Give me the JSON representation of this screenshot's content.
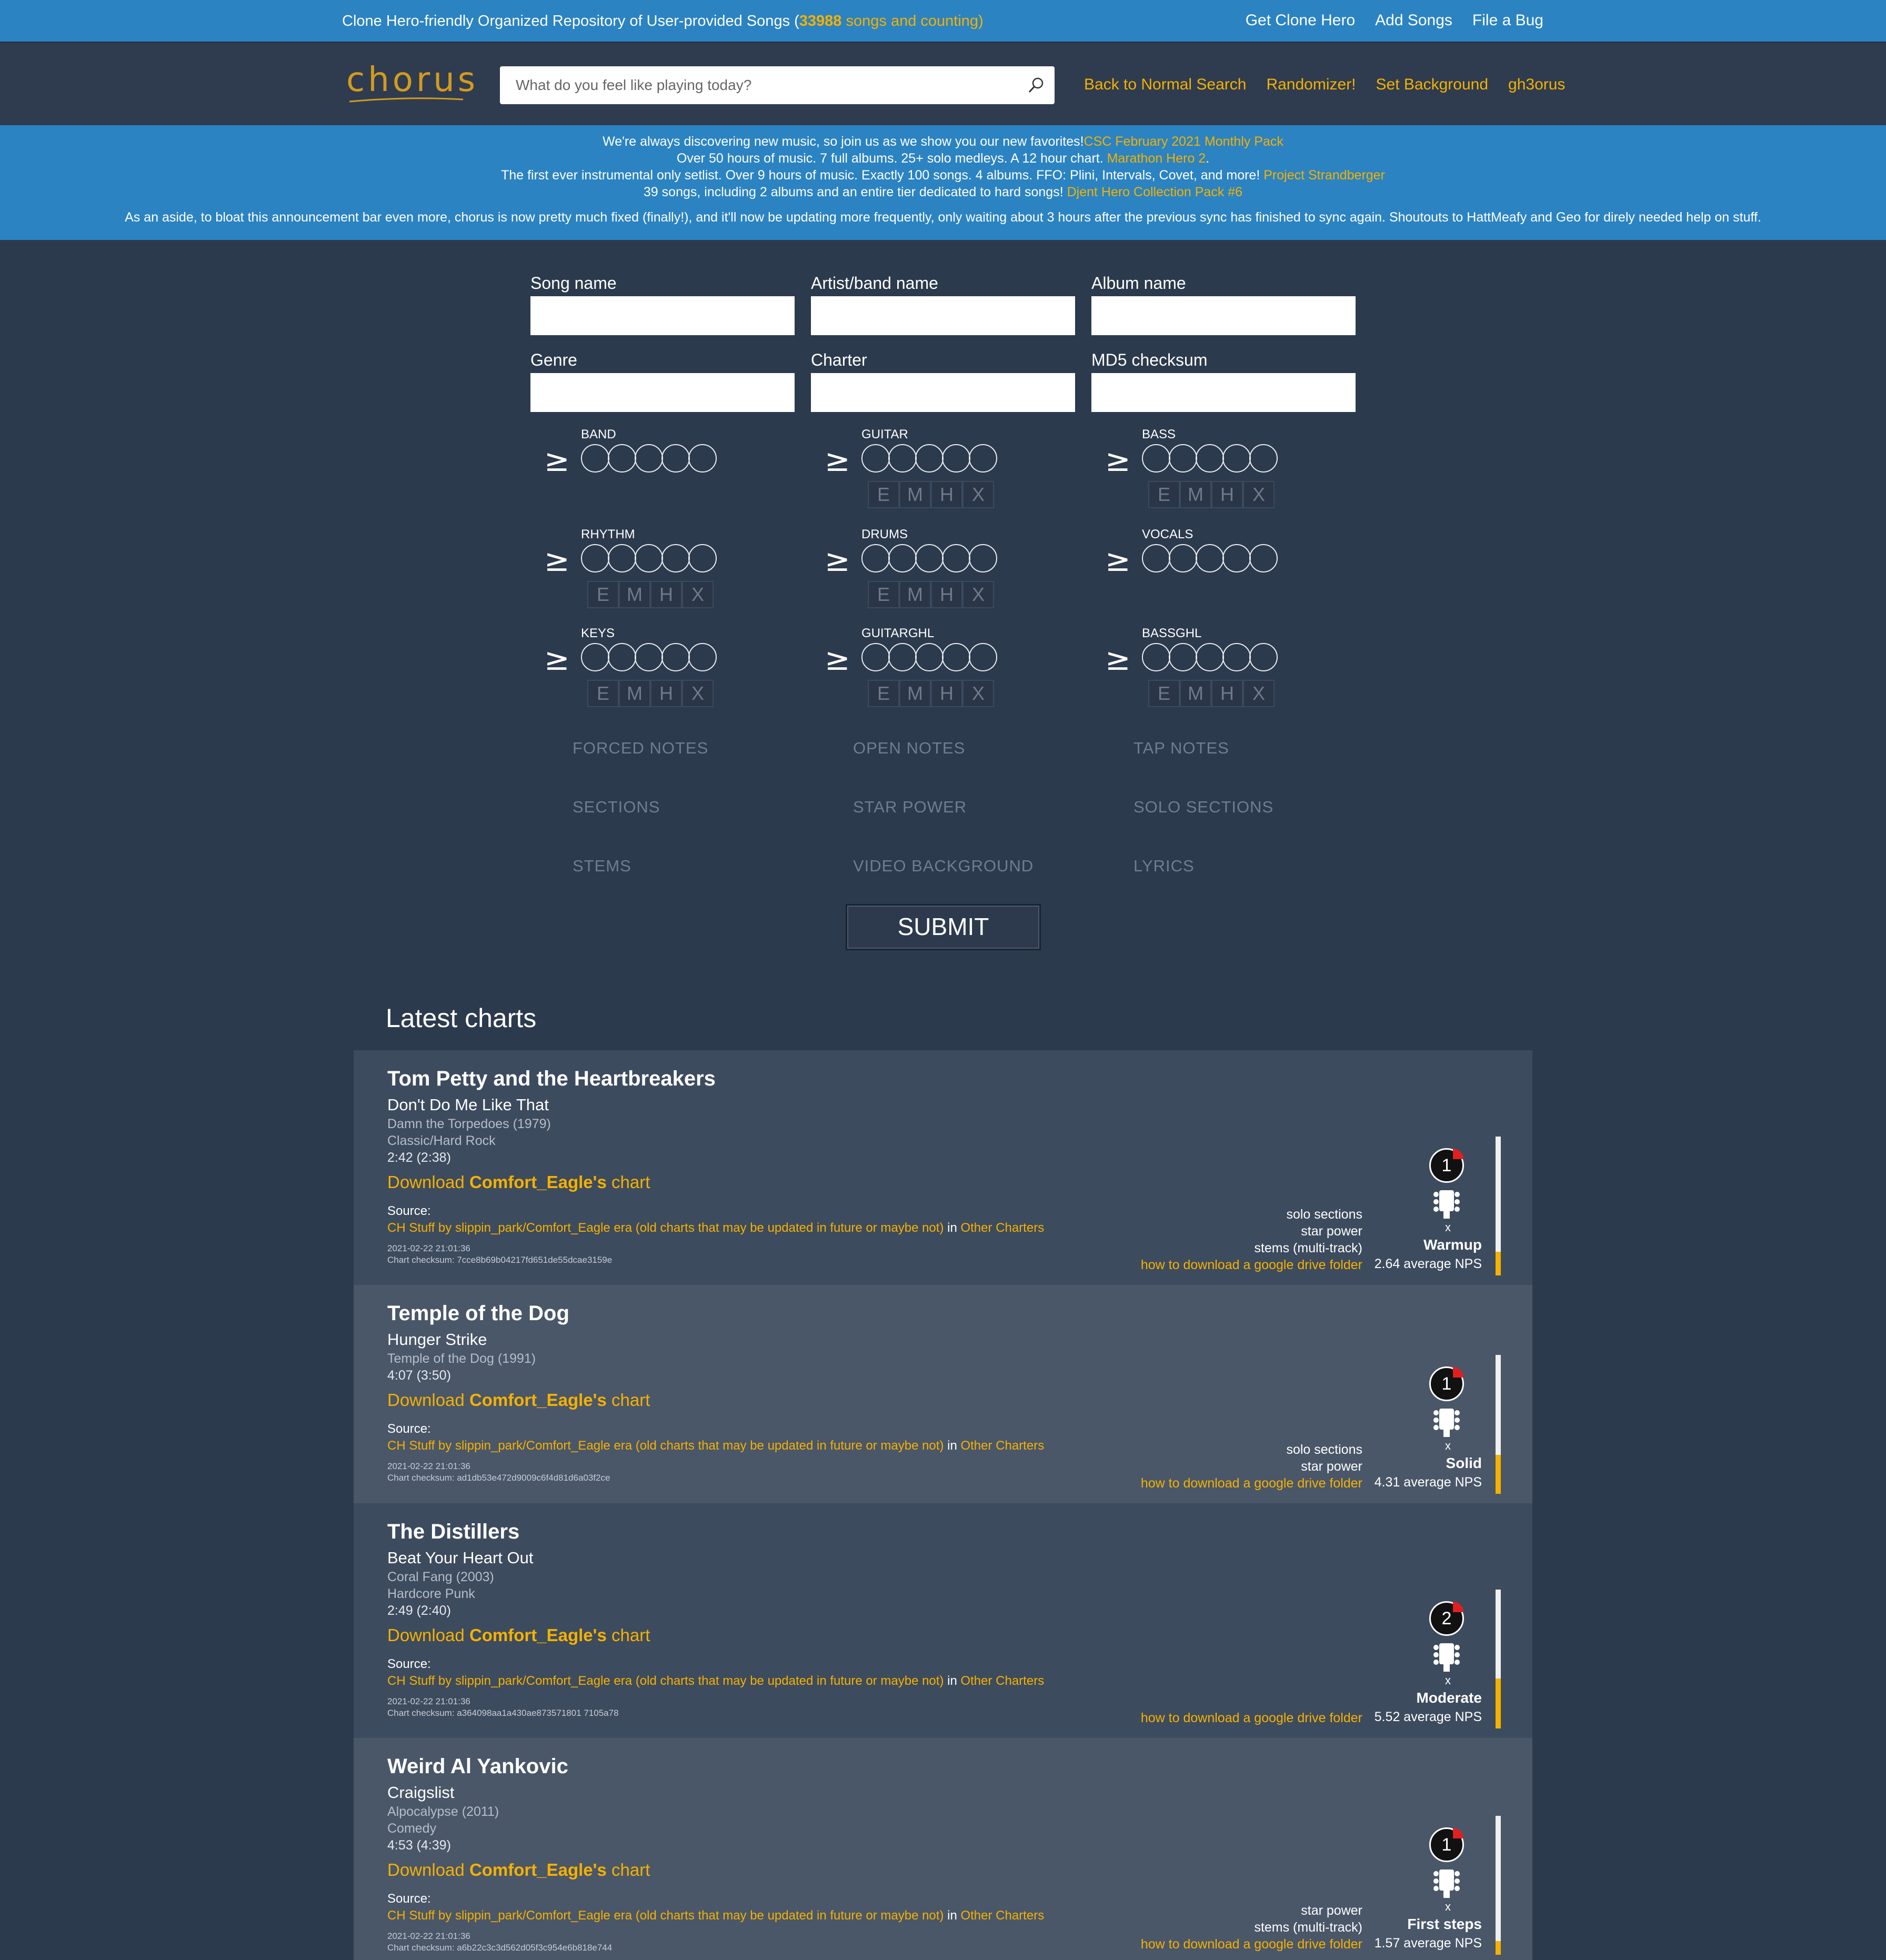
{
  "topbar": {
    "tagline_prefix": "Clone Hero-friendly Organized Repository of User-provided Songs (",
    "song_count": "33988",
    "tagline_suffix": " songs and counting)",
    "links": [
      "Get Clone Hero",
      "Add Songs",
      "File a Bug"
    ]
  },
  "header": {
    "logo": "chorus",
    "search_placeholder": "What do you feel like playing today?",
    "nav": [
      "Back to Normal Search",
      "Randomizer!",
      "Set Background",
      "gh3orus"
    ]
  },
  "announcement": {
    "lines": [
      {
        "text": "We're always discovering new music, so join us as we show you our new favorites!",
        "link": "CSC February 2021 Monthly Pack",
        "after": ""
      },
      {
        "text": "Over 50 hours of music. 7 full albums. 25+ solo medleys. A 12 hour chart. ",
        "link": "Marathon Hero 2",
        "after": "."
      },
      {
        "text": "The first ever instrumental only setlist. Over 9 hours of music. Exactly 100 songs. 4 albums. FFO: Plini, Intervals, Covet, and more! ",
        "link": "Project Strandberger",
        "after": ""
      },
      {
        "text": "39 songs, including 2 albums and an entire tier dedicated to hard songs! ",
        "link": "Djent Hero Collection Pack #6",
        "after": ""
      }
    ],
    "aside": "As an aside, to bloat this announcement bar even more, chorus is now pretty much fixed (finally!), and it'll now be updating more frequently, only waiting about 3 hours after the previous sync has finished to sync again. Shoutouts to HattMeafy and Geo for direly needed help on stuff."
  },
  "form": {
    "fields": [
      "Song name",
      "Artist/band name",
      "Album name",
      "Genre",
      "Charter",
      "MD5 checksum"
    ],
    "ge_symbol": "≥",
    "instruments": [
      {
        "name": "BAND",
        "diffs": []
      },
      {
        "name": "GUITAR",
        "diffs": [
          "E",
          "M",
          "H",
          "X"
        ]
      },
      {
        "name": "BASS",
        "diffs": [
          "E",
          "M",
          "H",
          "X"
        ]
      },
      {
        "name": "RHYTHM",
        "diffs": [
          "E",
          "M",
          "H",
          "X"
        ]
      },
      {
        "name": "DRUMS",
        "diffs": [
          "E",
          "M",
          "H",
          "X"
        ]
      },
      {
        "name": "VOCALS",
        "diffs": []
      },
      {
        "name": "KEYS",
        "diffs": [
          "E",
          "M",
          "H",
          "X"
        ]
      },
      {
        "name": "GUITARGHL",
        "diffs": [
          "E",
          "M",
          "H",
          "X"
        ]
      },
      {
        "name": "BASSGHL",
        "diffs": [
          "E",
          "M",
          "H",
          "X"
        ]
      }
    ],
    "features": [
      "FORCED NOTES",
      "OPEN NOTES",
      "TAP NOTES",
      "SECTIONS",
      "STAR POWER",
      "SOLO SECTIONS",
      "STEMS",
      "VIDEO BACKGROUND",
      "LYRICS"
    ],
    "submit": "SUBMIT"
  },
  "latest": {
    "title": "Latest charts",
    "cards": [
      {
        "artist": "Tom Petty and the Heartbreakers",
        "song": "Don't Do Me Like That",
        "album": "Damn the Torpedoes (1979)",
        "genre": "Classic/Hard Rock",
        "duration": "2:42 (2:38)",
        "dl_prefix": "Download ",
        "charter": "Comfort_Eagle's",
        "dl_suffix": " chart",
        "source_label": "Source:",
        "source": "CH Stuff by slippin_park/Comfort_Eagle era (old charts that may be updated in future or maybe not)",
        "in": " in ",
        "source_group": "Other Charters",
        "date": "2021-02-22 21:01:36",
        "checksum": "Chart checksum: 7cce8b69b04217fd651de55dcae3159e",
        "features": [
          "solo sections",
          "star power",
          "stems (multi-track)"
        ],
        "gdrive": "how to download a google drive folder",
        "difficulty": "1",
        "diff_letter": "x",
        "tier": "Warmup",
        "nps": "2.64 average NPS",
        "nps_fraction": 0.17
      },
      {
        "artist": "Temple of the Dog",
        "song": "Hunger Strike",
        "album": "Temple of the Dog (1991)",
        "genre": "",
        "duration": "4:07 (3:50)",
        "dl_prefix": "Download ",
        "charter": "Comfort_Eagle's",
        "dl_suffix": " chart",
        "source_label": "Source:",
        "source": "CH Stuff by slippin_park/Comfort_Eagle era (old charts that may be updated in future or maybe not)",
        "in": " in ",
        "source_group": "Other Charters",
        "date": "2021-02-22 21:01:36",
        "checksum": "Chart checksum: ad1db53e472d9009c6f4d81d6a03f2ce",
        "features": [
          "solo sections",
          "star power"
        ],
        "gdrive": "how to download a google drive folder",
        "difficulty": "1",
        "diff_letter": "x",
        "tier": "Solid",
        "nps": "4.31 average NPS",
        "nps_fraction": 0.28
      },
      {
        "artist": "The Distillers",
        "song": "Beat Your Heart Out",
        "album": "Coral Fang (2003)",
        "genre": "Hardcore Punk",
        "duration": "2:49 (2:40)",
        "dl_prefix": "Download ",
        "charter": "Comfort_Eagle's",
        "dl_suffix": " chart",
        "source_label": "Source:",
        "source": "CH Stuff by slippin_park/Comfort_Eagle era (old charts that may be updated in future or maybe not)",
        "in": " in ",
        "source_group": "Other Charters",
        "date": "2021-02-22 21:01:36",
        "checksum": "Chart checksum: a364098aa1a430ae873571801 7105a78",
        "features": [],
        "gdrive": "how to download a google drive folder",
        "difficulty": "2",
        "diff_letter": "x",
        "tier": "Moderate",
        "nps": "5.52 average NPS",
        "nps_fraction": 0.36
      },
      {
        "artist": "Weird Al Yankovic",
        "song": "Craigslist",
        "album": "Alpocalypse (2011)",
        "genre": "Comedy",
        "duration": "4:53 (4:39)",
        "dl_prefix": "Download ",
        "charter": "Comfort_Eagle's",
        "dl_suffix": " chart",
        "source_label": "Source:",
        "source": "CH Stuff by slippin_park/Comfort_Eagle era (old charts that may be updated in future or maybe not)",
        "in": " in ",
        "source_group": "Other Charters",
        "date": "2021-02-22 21:01:36",
        "checksum": "Chart checksum: a6b22c3c3d562d05f3c954e6b818e744",
        "features": [
          "star power",
          "stems (multi-track)"
        ],
        "gdrive": "how to download a google drive folder",
        "difficulty": "1",
        "diff_letter": "x",
        "tier": "First steps",
        "nps": "1.57 average NPS",
        "nps_fraction": 0.1
      }
    ]
  },
  "colors": {
    "accent": "#f5b100",
    "topbar": "#2b83c2",
    "background": "#2c3a4d",
    "card_a": "#3d4b5e",
    "card_b": "#4a5769"
  }
}
